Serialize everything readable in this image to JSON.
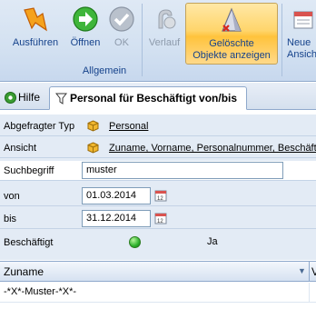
{
  "ribbon": {
    "buttons": [
      {
        "label": "Ausführen",
        "icon": "lightning-icon",
        "enabled": true
      },
      {
        "label": "Öffnen",
        "icon": "arrow-right-icon",
        "enabled": true
      },
      {
        "label": "OK",
        "icon": "check-icon",
        "enabled": false
      },
      {
        "label": "Verlauf",
        "icon": "history-icon",
        "enabled": false
      },
      {
        "label": "Gelöschte Objekte anzeigen",
        "icon": "deleted-objects-icon",
        "enabled": true,
        "active": true
      },
      {
        "label": "Neue Ansicht",
        "icon": "new-view-icon",
        "enabled": true
      }
    ],
    "group_label": "Allgemein"
  },
  "tabs": [
    {
      "label": "Hilfe",
      "icon": "help-icon"
    },
    {
      "label": "Personal für Beschäftigt von/bis",
      "icon": "filter-icon",
      "active": true
    }
  ],
  "props": {
    "type_label": "Abgefragter Typ",
    "type_value": "Personal",
    "view_label": "Ansicht",
    "view_value": "Zuname, Vorname, Personalnummer, Beschäftigt",
    "search_label": "Suchbegriff",
    "search_value": "muster",
    "from_label": "von",
    "from_value": "01.03.2014",
    "to_label": "bis",
    "to_value": "31.12.2014",
    "employed_label": "Beschäftigt",
    "employed_value": "Ja"
  },
  "grid": {
    "columns": [
      "Zuname",
      "V"
    ],
    "rows": [
      [
        "-*X*-Muster-*X*-",
        ""
      ]
    ]
  },
  "colors": {
    "accent": "#15428b",
    "ribbon_bg": "#d3e1f1",
    "active_button": "#ffd56b",
    "status_green": "#2eb22e"
  }
}
